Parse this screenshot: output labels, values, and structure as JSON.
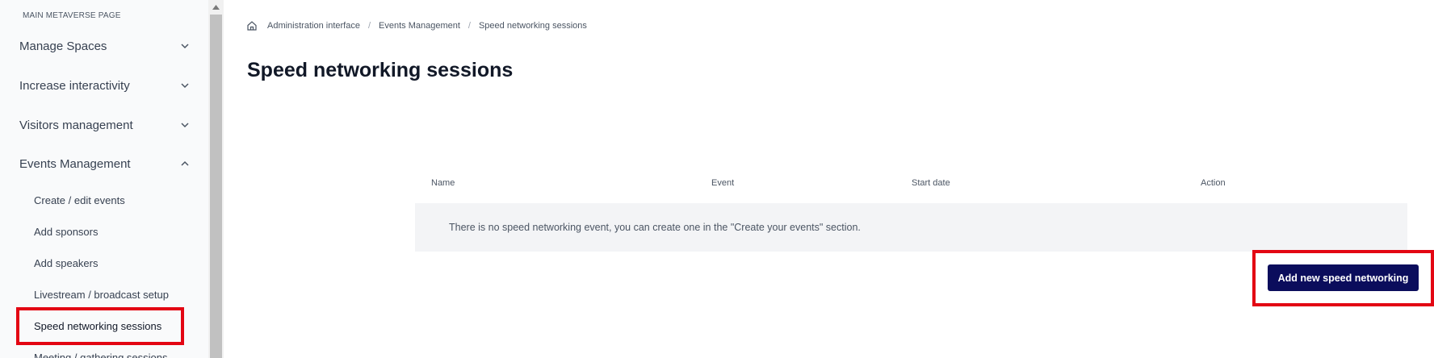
{
  "sidebar": {
    "section_label": "MAIN METAVERSE PAGE",
    "items": [
      {
        "label": "Manage Spaces",
        "chevron": "chevron-down-icon"
      },
      {
        "label": "Increase interactivity",
        "chevron": "chevron-down-icon"
      },
      {
        "label": "Visitors management",
        "chevron": "chevron-down-icon"
      },
      {
        "label": "Events Management",
        "chevron": "chevron-up-icon"
      }
    ],
    "sub_items": [
      {
        "label": "Create / edit events"
      },
      {
        "label": "Add sponsors"
      },
      {
        "label": "Add speakers"
      },
      {
        "label": "Livestream / broadcast setup"
      },
      {
        "label": "Speed networking sessions",
        "active": true
      },
      {
        "label": "Meeting / gathering sessions"
      }
    ]
  },
  "breadcrumb": {
    "home_icon": "home-icon",
    "items": [
      "Administration interface",
      "Events Management",
      "Speed networking sessions"
    ]
  },
  "page": {
    "title": "Speed networking sessions"
  },
  "table": {
    "columns": [
      "Name",
      "Event",
      "Start date",
      "Action"
    ],
    "empty_message": "There is no speed networking event, you can create one in the \"Create your events\" section."
  },
  "actions": {
    "add_button_label": "Add new speed networking"
  },
  "colors": {
    "accent": "#0b0d5c",
    "highlight": "#e30613",
    "sidebar_bg": "#f9fafb",
    "empty_row_bg": "#f3f4f6"
  }
}
